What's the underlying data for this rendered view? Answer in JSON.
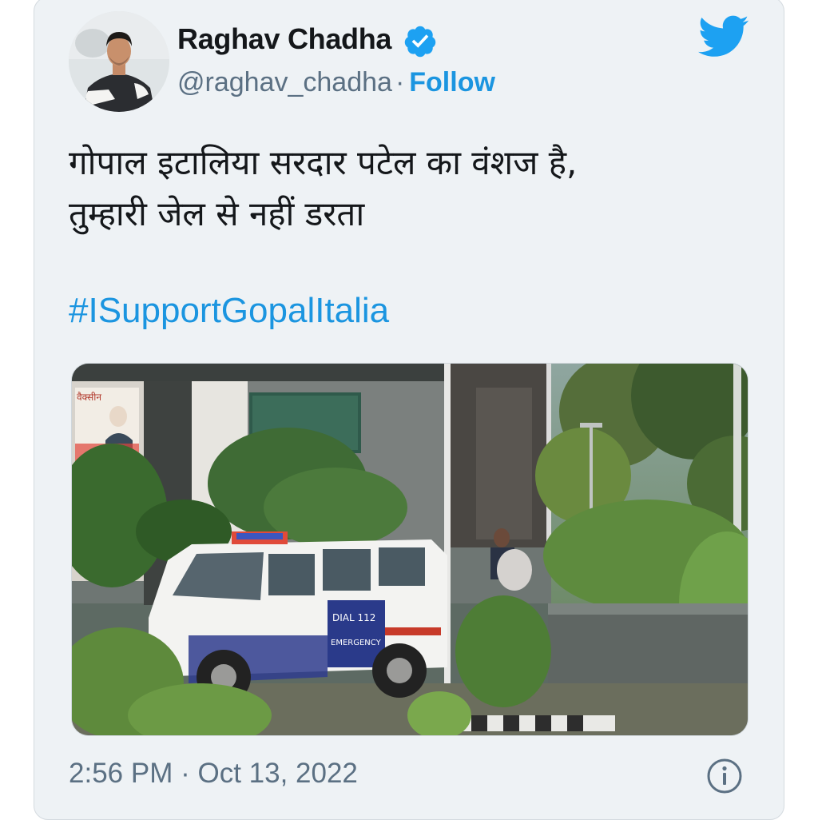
{
  "tweet": {
    "author": {
      "name": "Raghav Chadha",
      "handle": "@raghav_chadha",
      "separator": "·",
      "follow_label": "Follow",
      "verified": true
    },
    "text_line1": "गोपाल इटालिया सरदार पटेल का वंशज है,",
    "text_line2": "तुम्हारी जेल से नहीं डरता",
    "hashtag": "#ISupportGopalItalia",
    "time": "2:56 PM",
    "date_separator": "·",
    "date": "Oct 13, 2022",
    "media": {
      "vehicle_text_dial": "DIAL 112",
      "vehicle_text_emergency": "EMERGENCY"
    }
  },
  "icons": {
    "brand": "twitter-bird-icon",
    "verified": "verified-badge-icon",
    "info": "info-icon"
  },
  "colors": {
    "card_background": "#eef2f5",
    "link_blue": "#1b95e0",
    "text_primary": "#14171a",
    "text_secondary": "#5b7083",
    "verified_blue": "#1da1f2"
  }
}
